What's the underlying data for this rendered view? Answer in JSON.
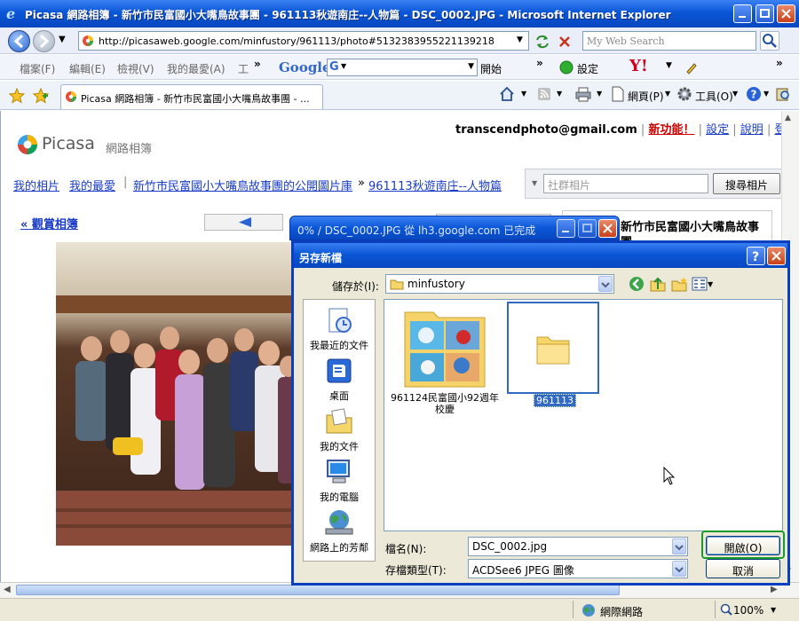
{
  "window": {
    "title": "Picasa 網路相簿 - 新竹市民富國小大嘴鳥故事團 - 961113秋遊南庄--人物篇 - DSC_0002.JPG - Microsoft Internet Explorer"
  },
  "address": {
    "url": "http://picasaweb.google.com/minfustory/961113/photo#5132383955221139218",
    "search_placeholder": "My Web Search"
  },
  "menu": {
    "items": [
      "檔案(F)",
      "編輯(E)",
      "檢視(V)",
      "我的最愛(A)",
      "工"
    ],
    "google_label": "Google",
    "open_label": "開始",
    "settings_label": "設定",
    "yahoo_label": "Y!"
  },
  "tabs": {
    "active_tab": "Picasa 網路相簿 - 新竹市民富國小大嘴鳥故事團 - ...",
    "page_label": "網頁(P)",
    "tools_label": "工具(O)"
  },
  "page": {
    "account_email": "transcendphoto@gmail.com",
    "new_feature": "新功能！",
    "settings_link": "設定",
    "help_link": "說明",
    "logout_link": "登出",
    "logo_text": "Picasa",
    "logo_sub": "網路相簿",
    "nav_my_photos": "我的相片",
    "nav_favorites": "我的最愛",
    "breadcrumb_gallery": "新竹市民富國小大嘴鳥故事團的公開圖片庫",
    "breadcrumb_sep": "»",
    "breadcrumb_album": "961113秋遊南庄--人物篇",
    "community_search_placeholder": "社群相片",
    "search_button": "搜尋相片",
    "back_link": "« 觀賞相簿",
    "side_title": "新竹市民富國小大嘴鳥故事團"
  },
  "progress_window": {
    "title": "0% / DSC_0002.JPG 從 lh3.google.com 已完成"
  },
  "dialog": {
    "title": "另存新檔",
    "save_in_label": "儲存於(I):",
    "save_in_value": "minfustory",
    "places": [
      "我最近的文件",
      "桌面",
      "我的文件",
      "我的電腦",
      "網路上的芳鄰"
    ],
    "folders": [
      {
        "name": "961124民富國小92週年校慶",
        "selected": false
      },
      {
        "name": "961113",
        "selected": true
      }
    ],
    "filename_label": "檔名(N):",
    "filename_value": "DSC_0002.jpg",
    "filetype_label": "存檔類型(T):",
    "filetype_value": "ACDSee6 JPEG 圖像",
    "open_button": "開啟(O)",
    "cancel_button": "取消"
  },
  "status": {
    "zone": "網際網路",
    "zoom": "100%"
  }
}
